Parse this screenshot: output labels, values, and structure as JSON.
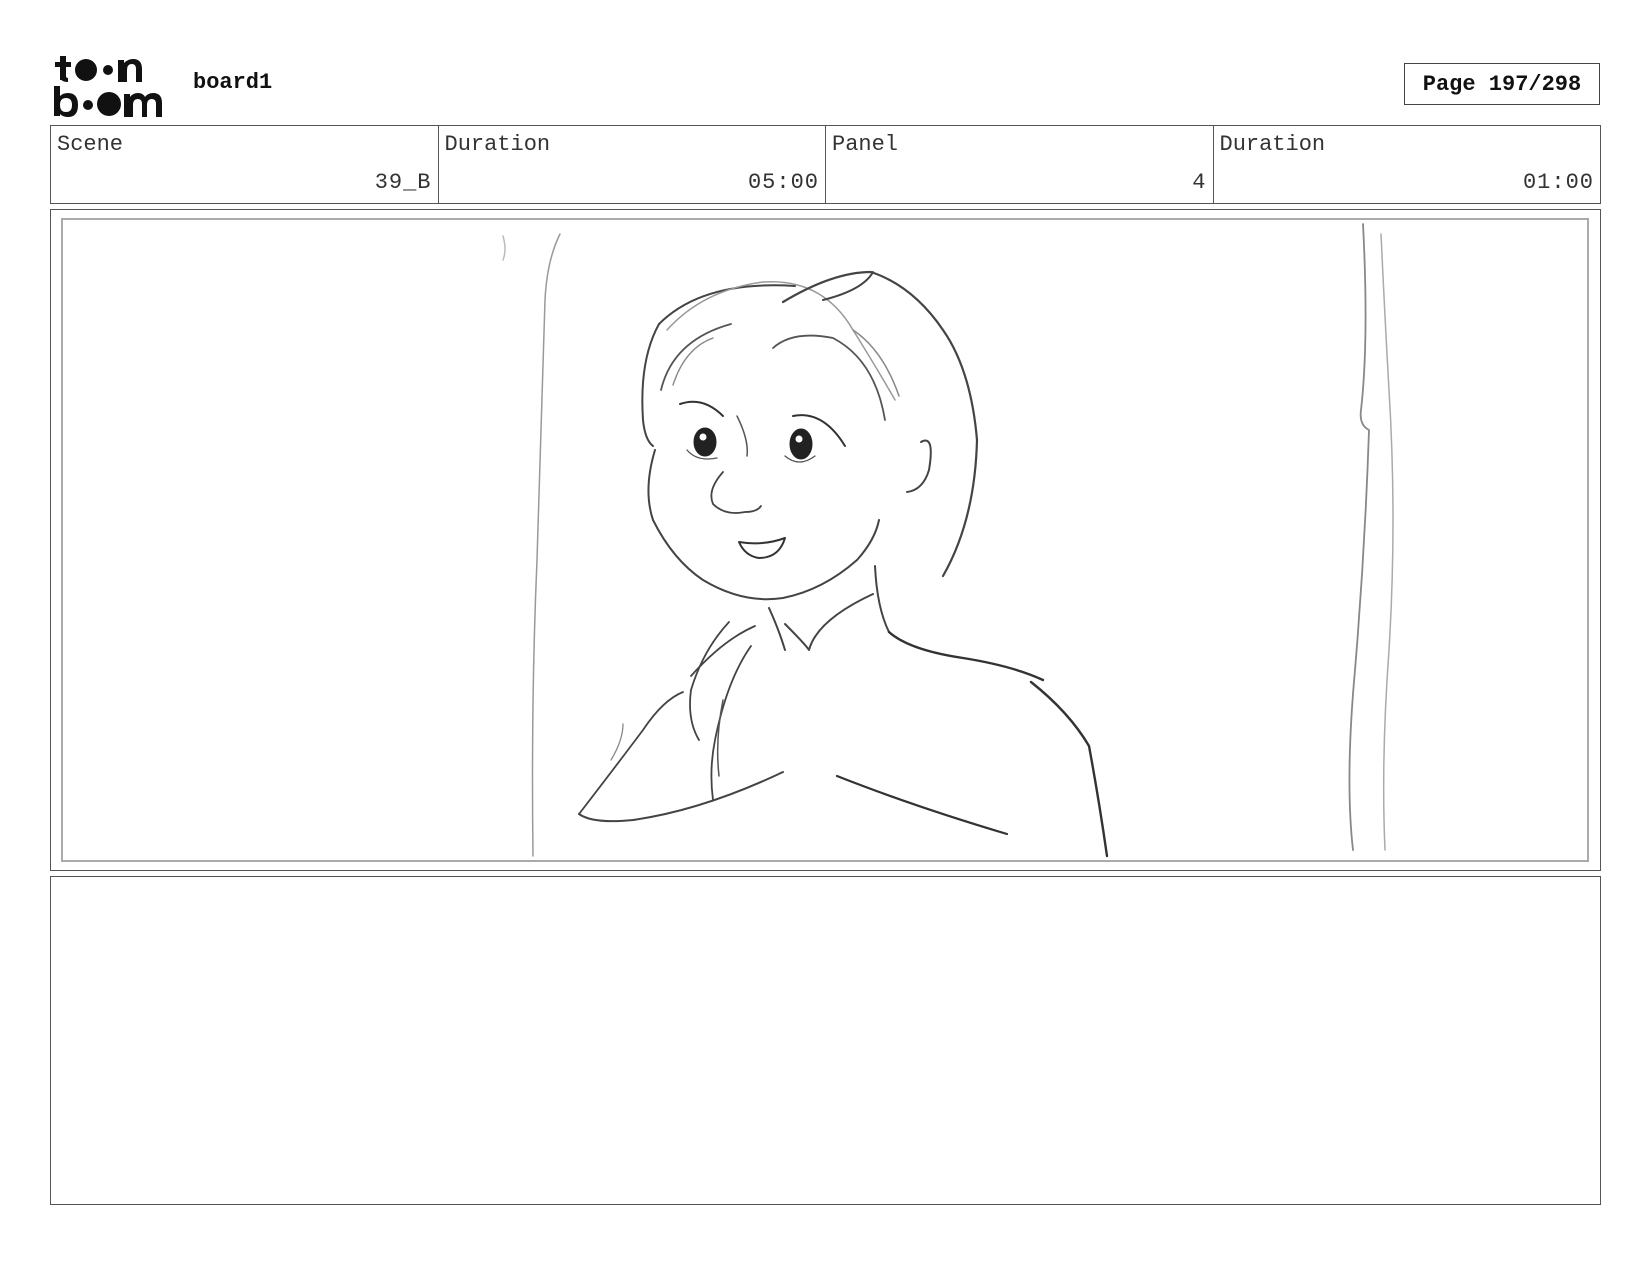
{
  "header": {
    "logo_text": "toon boom",
    "board_name": "board1",
    "page_label": "Page 197/298"
  },
  "info": {
    "scene_label": "Scene",
    "scene_value": "39_B",
    "scene_duration_label": "Duration",
    "scene_duration_value": "05:00",
    "panel_label": "Panel",
    "panel_value": "4",
    "panel_duration_label": "Duration",
    "panel_duration_value": "01:00"
  },
  "notes": {
    "text": ""
  }
}
